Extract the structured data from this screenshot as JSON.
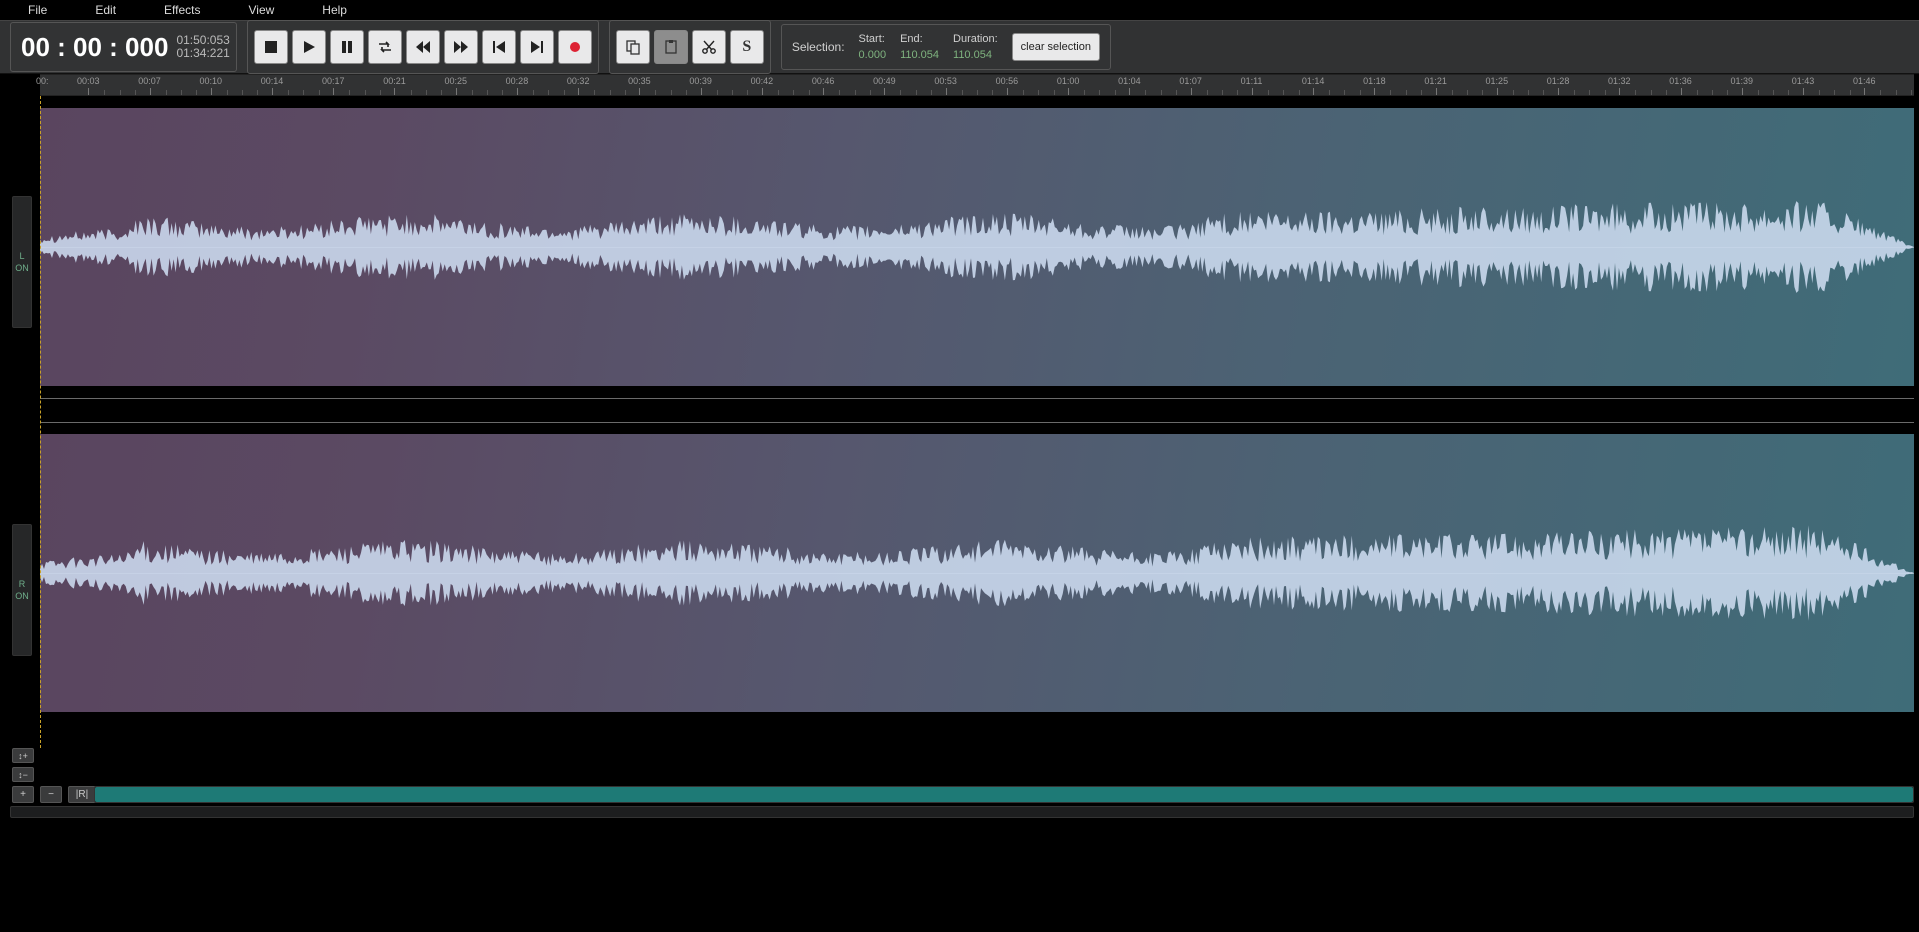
{
  "menu": {
    "file": "File",
    "edit": "Edit",
    "effects": "Effects",
    "view": "View",
    "help": "Help"
  },
  "counter": {
    "main": "00 : 00 : 000",
    "sub1": "01:50:053",
    "sub2": "01:34:221"
  },
  "selection": {
    "label": "Selection:",
    "start_k": "Start:",
    "start_v": "0.000",
    "end_k": "End:",
    "end_v": "110.054",
    "dur_k": "Duration:",
    "dur_v": "110.054",
    "clear": "clear selection"
  },
  "snap_label": "S",
  "channels": {
    "left": "L",
    "right": "R",
    "on": "ON"
  },
  "zoom": {
    "vplus": "↕+",
    "vminus": "↕−",
    "hplus": "+",
    "hminus": "−",
    "fit": "|R|"
  },
  "ruler": {
    "start": "00:",
    "ticks": [
      "00:03",
      "00:07",
      "00:10",
      "00:14",
      "00:17",
      "00:21",
      "00:25",
      "00:28",
      "00:32",
      "00:35",
      "00:39",
      "00:42",
      "00:46",
      "00:49",
      "00:53",
      "00:56",
      "01:00",
      "01:04",
      "01:07",
      "01:11",
      "01:14",
      "01:18",
      "01:21",
      "01:25",
      "01:28",
      "01:32",
      "01:36",
      "01:39",
      "01:43",
      "01:46"
    ]
  }
}
